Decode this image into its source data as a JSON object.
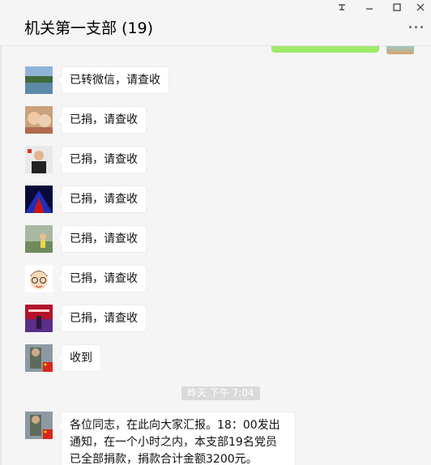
{
  "window": {
    "title": "机关第一支部 (19)",
    "controls": [
      "pin-icon",
      "minimize-icon",
      "maximize-icon",
      "close-icon"
    ]
  },
  "messages": [
    {
      "avatar": "avatar-lake",
      "text": "已转微信，请查收"
    },
    {
      "avatar": "avatar-kids",
      "text": "已捐，请查收"
    },
    {
      "avatar": "avatar-man",
      "text": "已捐，请查收"
    },
    {
      "avatar": "avatar-stage",
      "text": "已捐，请查收"
    },
    {
      "avatar": "avatar-outdoor",
      "text": "已捐，请查收"
    },
    {
      "avatar": "avatar-cartoon",
      "text": "已捐，请查收"
    },
    {
      "avatar": "avatar-poster",
      "text": "已捐，请查收"
    },
    {
      "avatar": "avatar-flag",
      "text": "收到"
    }
  ],
  "timestamp": "昨天 下午 7:04",
  "last_message": {
    "avatar": "avatar-flag",
    "text": "各位同志，在此向大家汇报。18：00发出通知，在一个小时之内，本支部19名党员已全部捐款，捐款合计金额3200元。"
  },
  "colors": {
    "sent_bubble": "#9eea6a",
    "background": "#f5f5f5",
    "bubble": "#ffffff"
  }
}
